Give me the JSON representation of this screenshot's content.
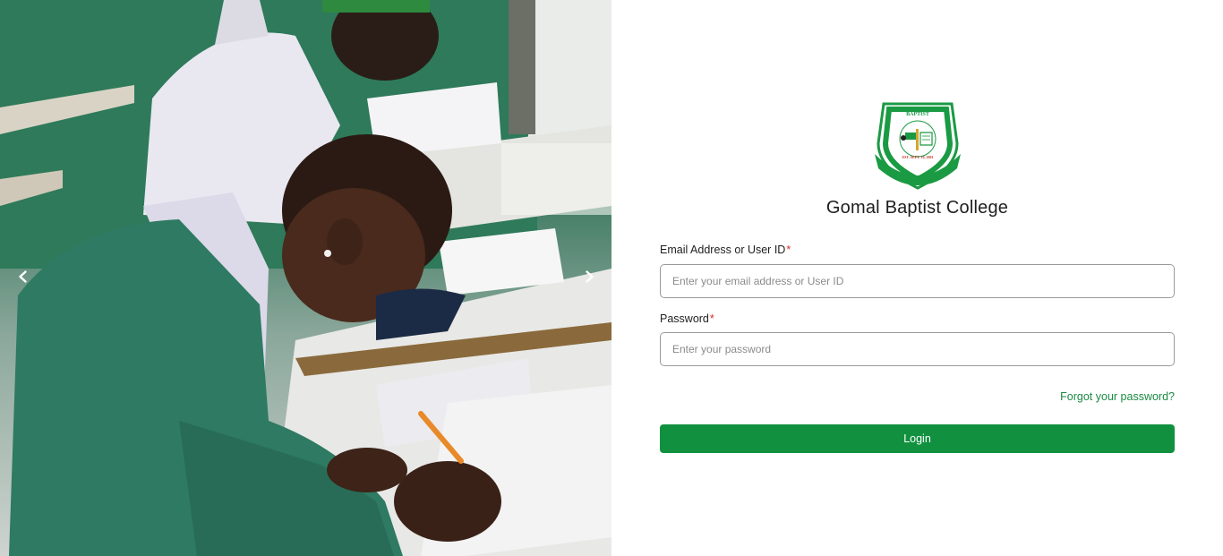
{
  "carousel": {
    "prev_icon": "chevron-left-icon",
    "next_icon": "chevron-right-icon"
  },
  "brand": {
    "school_name": "Gomal Baptist College",
    "logo_icon": "school-crest-icon",
    "logo_text_top": "GOMAL BAPTIST COLLEGE",
    "logo_text_bottom": "ARISE AND SHINE",
    "logo_est": "EST. SEPT. 10, 2001",
    "accent_color": "#11913f"
  },
  "form": {
    "email_label": "Email Address or User ID",
    "email_placeholder": "Enter your email address or User ID",
    "password_label": "Password",
    "password_placeholder": "Enter your password",
    "required_marker": "*",
    "forgot_link": "Forgot your password?",
    "login_button": "Login"
  }
}
